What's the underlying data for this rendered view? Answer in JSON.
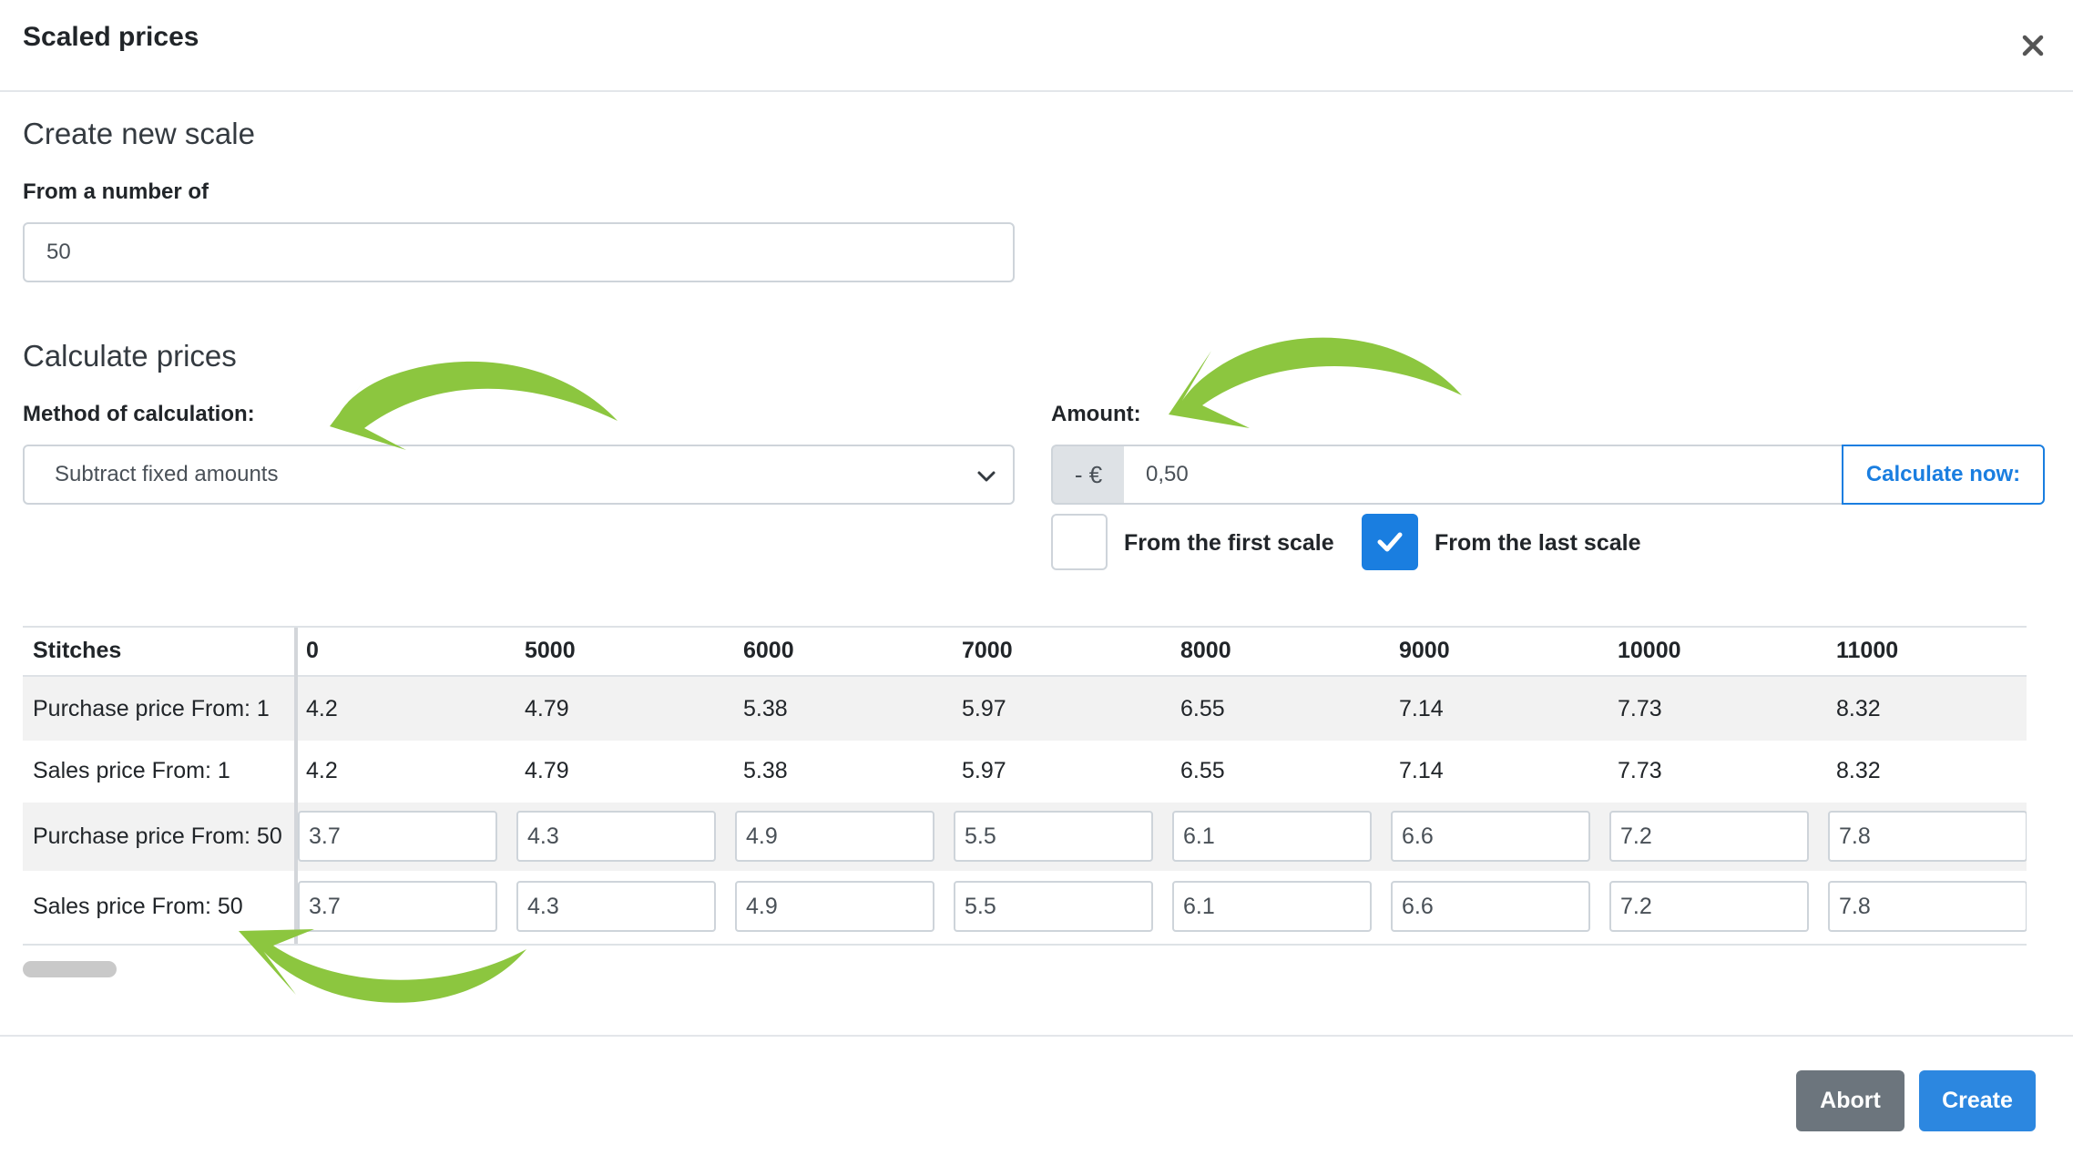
{
  "modal": {
    "title": "Scaled prices",
    "close_icon": "close-icon"
  },
  "create_scale": {
    "heading": "Create new scale",
    "from_number_label": "From a number of",
    "from_number_value": "50"
  },
  "calculate": {
    "heading": "Calculate prices",
    "method_label": "Method of calculation:",
    "method_selected": "Subtract fixed amounts",
    "amount_label": "Amount:",
    "amount_prefix": "- €",
    "amount_value": "0,50",
    "calculate_button": "Calculate now:",
    "option_first_scale": {
      "label": "From the first scale",
      "checked": false
    },
    "option_last_scale": {
      "label": "From the last scale",
      "checked": true
    }
  },
  "table": {
    "header_label": "Stitches",
    "columns": [
      "0",
      "5000",
      "6000",
      "7000",
      "8000",
      "9000",
      "10000",
      "11000"
    ],
    "rows": [
      {
        "label": "Purchase price From: 1",
        "editable": false,
        "values": [
          "4.2",
          "4.79",
          "5.38",
          "5.97",
          "6.55",
          "7.14",
          "7.73",
          "8.32"
        ]
      },
      {
        "label": "Sales price From: 1",
        "editable": false,
        "values": [
          "4.2",
          "4.79",
          "5.38",
          "5.97",
          "6.55",
          "7.14",
          "7.73",
          "8.32"
        ]
      },
      {
        "label": "Purchase price From: 50",
        "editable": true,
        "values": [
          "3.7",
          "4.3",
          "4.9",
          "5.5",
          "6.1",
          "6.6",
          "7.2",
          "7.8"
        ]
      },
      {
        "label": "Sales price From: 50",
        "editable": true,
        "values": [
          "3.7",
          "4.3",
          "4.9",
          "5.5",
          "6.1",
          "6.6",
          "7.2",
          "7.8"
        ]
      }
    ]
  },
  "footer": {
    "abort_label": "Abort",
    "create_label": "Create"
  },
  "colors": {
    "primary": "#1a7ee0",
    "secondary": "#6c757d",
    "annotation_arrow": "#8cc63f"
  }
}
